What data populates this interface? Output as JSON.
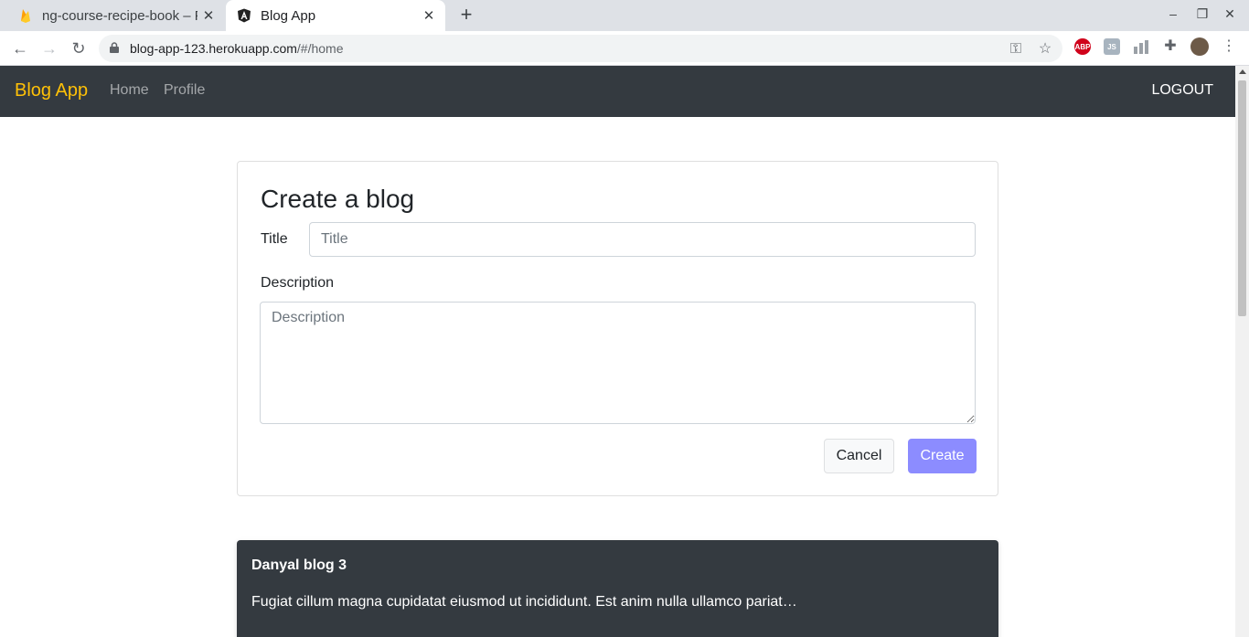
{
  "browser": {
    "tabs": [
      {
        "title": "ng-course-recipe-book – F",
        "favicon": "firebase-icon"
      },
      {
        "title": "Blog App",
        "favicon": "angular-icon"
      }
    ],
    "url_host": "blog-app-123.herokuapp.com",
    "url_path": "/#/home"
  },
  "navbar": {
    "brand": "Blog App",
    "links": [
      "Home",
      "Profile"
    ],
    "logout": "LOGOUT",
    "brand_color": "#ffc107",
    "background": "#343a40"
  },
  "form": {
    "heading": "Create a blog",
    "title_label": "Title",
    "title_placeholder": "Title",
    "description_label": "Description",
    "description_placeholder": "Description",
    "cancel_label": "Cancel",
    "create_label": "Create"
  },
  "posts": [
    {
      "title": "Danyal blog 3",
      "excerpt": "Fugiat cillum magna cupidatat eiusmod ut incididunt. Est anim nulla ullamco pariat…"
    }
  ]
}
